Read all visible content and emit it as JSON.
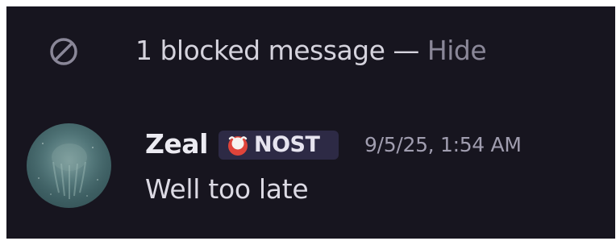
{
  "blocked_notice": {
    "icon": "blocked-icon",
    "text": "1 blocked message",
    "separator": " — ",
    "hide_label": "Hide"
  },
  "message": {
    "author": "Zeal",
    "tag": {
      "icon": "nost-logo-icon",
      "label": "NOST",
      "background": "#2d2a45"
    },
    "timestamp": "9/5/25, 1:54 AM",
    "body": "Well too late"
  },
  "colors": {
    "panel_background": "#17151f",
    "hide_link": "#8a8798",
    "timestamp": "#a09daf",
    "tag_logo": "#e0443a"
  }
}
